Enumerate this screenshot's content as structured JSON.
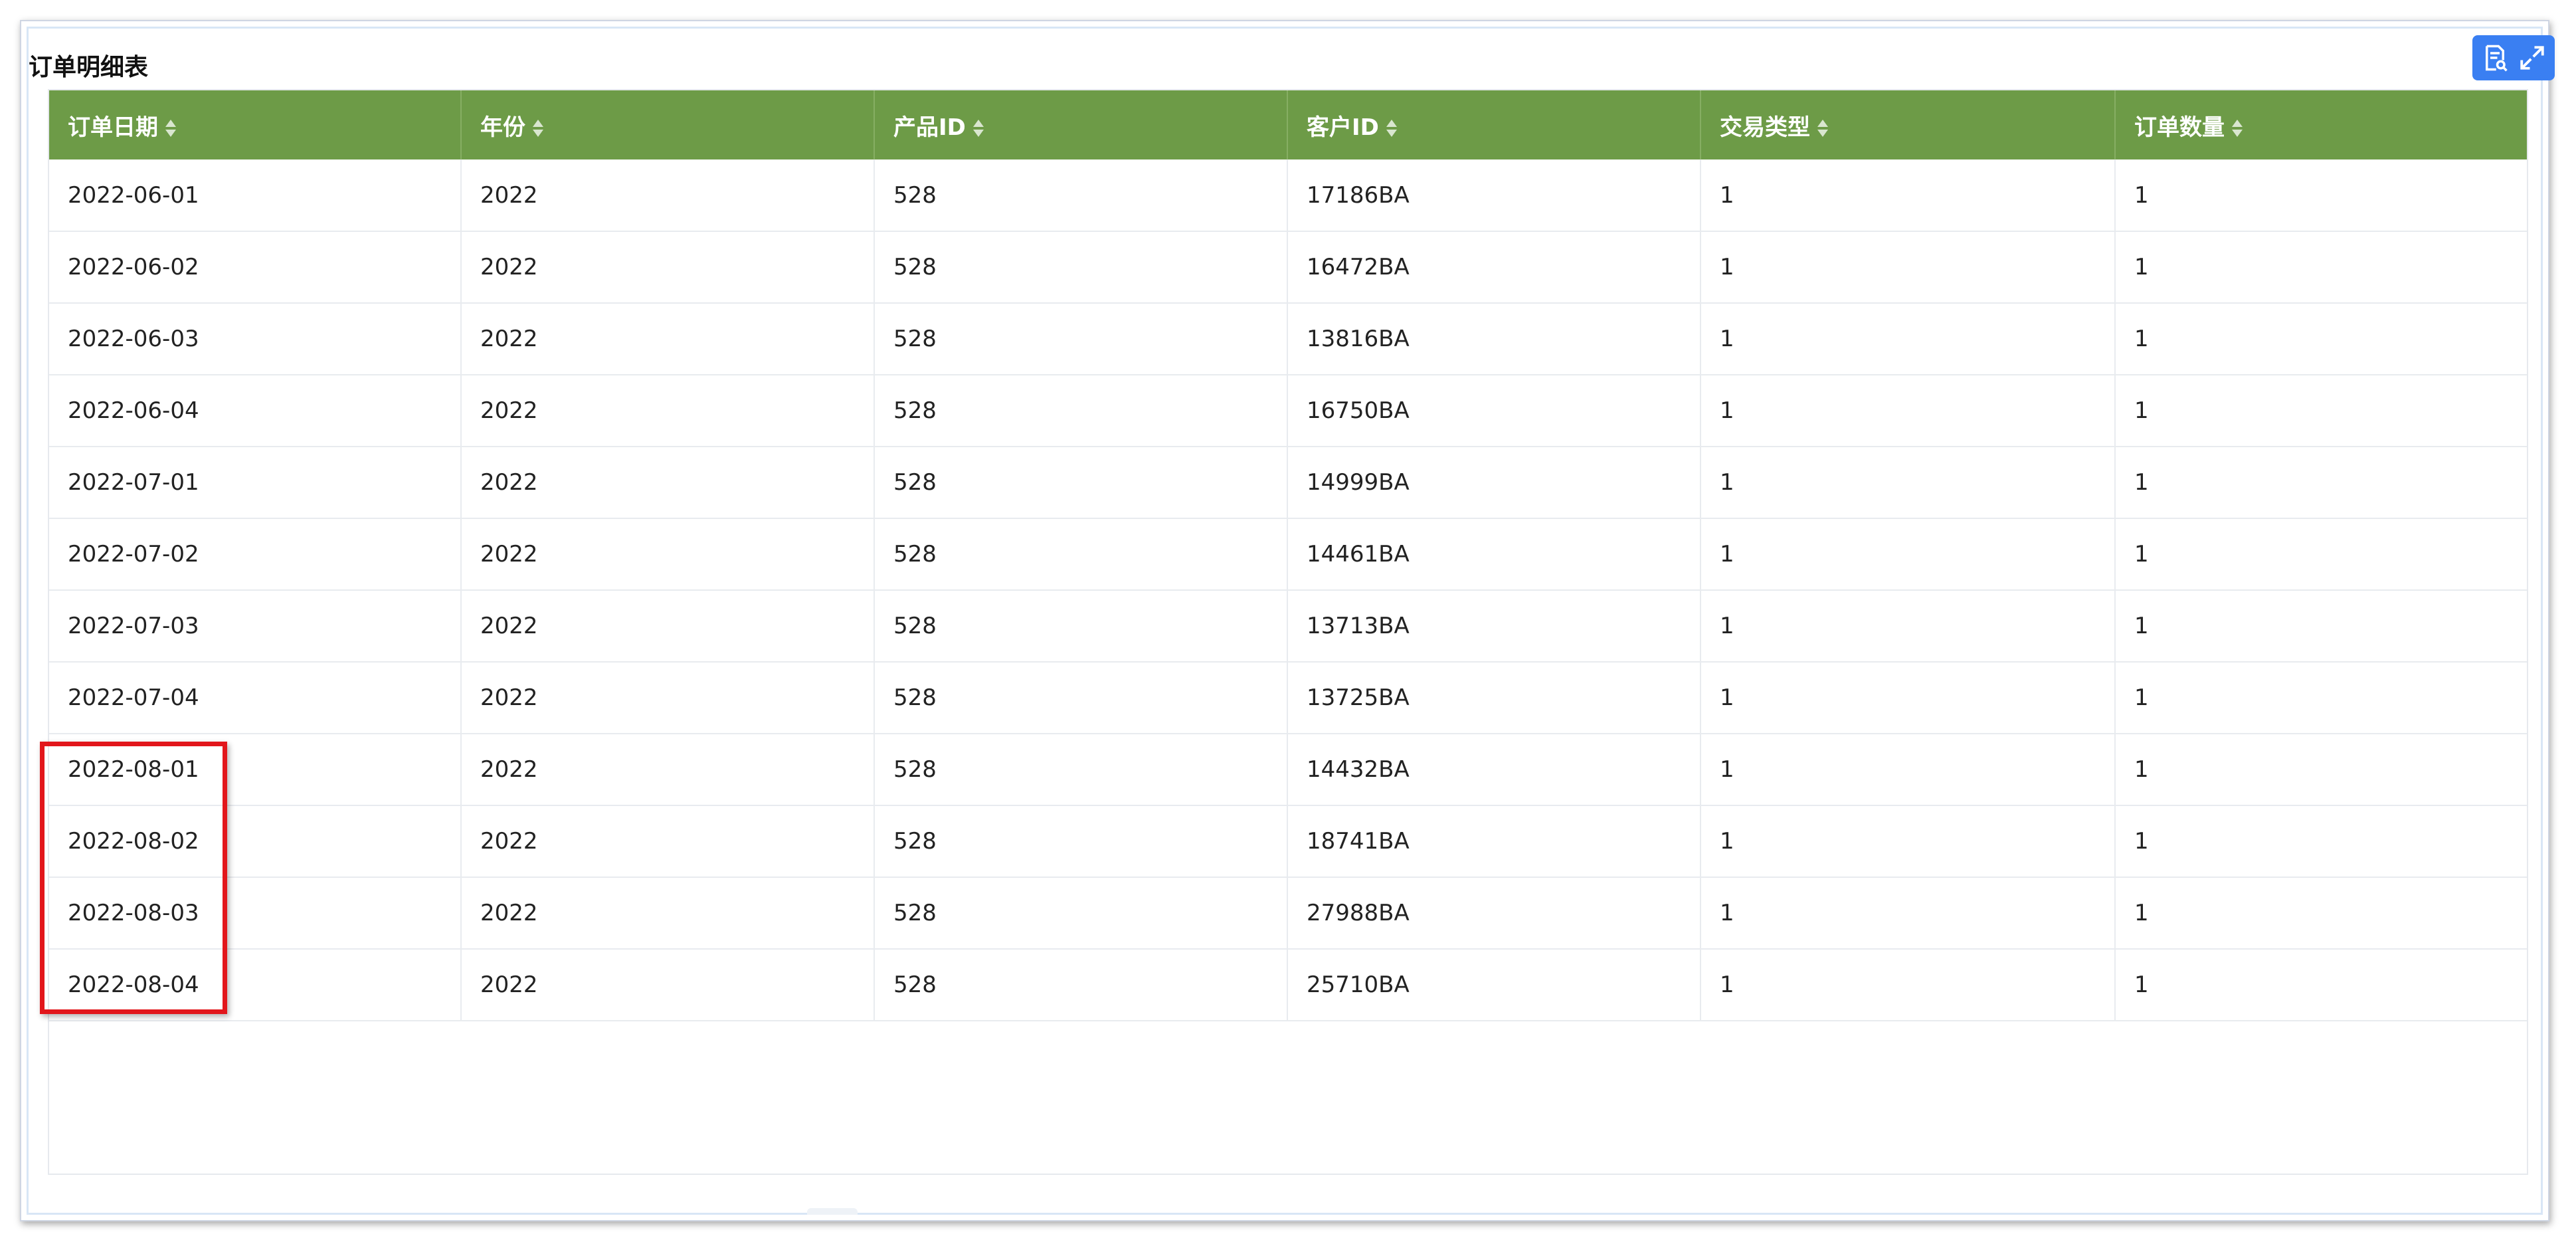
{
  "title": "订单明细表",
  "toolbar": {
    "icons": [
      "report-view-icon",
      "expand-icon"
    ],
    "accent_color": "#3a7ff2"
  },
  "table": {
    "header_color": "#6d9b47",
    "columns": [
      "订单日期",
      "年份",
      "产品ID",
      "客户ID",
      "交易类型",
      "订单数量"
    ],
    "rows": [
      [
        "2022-06-01",
        "2022",
        "528",
        "17186BA",
        "1",
        "1"
      ],
      [
        "2022-06-02",
        "2022",
        "528",
        "16472BA",
        "1",
        "1"
      ],
      [
        "2022-06-03",
        "2022",
        "528",
        "13816BA",
        "1",
        "1"
      ],
      [
        "2022-06-04",
        "2022",
        "528",
        "16750BA",
        "1",
        "1"
      ],
      [
        "2022-07-01",
        "2022",
        "528",
        "14999BA",
        "1",
        "1"
      ],
      [
        "2022-07-02",
        "2022",
        "528",
        "14461BA",
        "1",
        "1"
      ],
      [
        "2022-07-03",
        "2022",
        "528",
        "13713BA",
        "1",
        "1"
      ],
      [
        "2022-07-04",
        "2022",
        "528",
        "13725BA",
        "1",
        "1"
      ],
      [
        "2022-08-01",
        "2022",
        "528",
        "14432BA",
        "1",
        "1"
      ],
      [
        "2022-08-02",
        "2022",
        "528",
        "18741BA",
        "1",
        "1"
      ],
      [
        "2022-08-03",
        "2022",
        "528",
        "27988BA",
        "1",
        "1"
      ],
      [
        "2022-08-04",
        "2022",
        "528",
        "25710BA",
        "1",
        "1"
      ]
    ]
  },
  "highlight": {
    "color": "#e2161b"
  }
}
